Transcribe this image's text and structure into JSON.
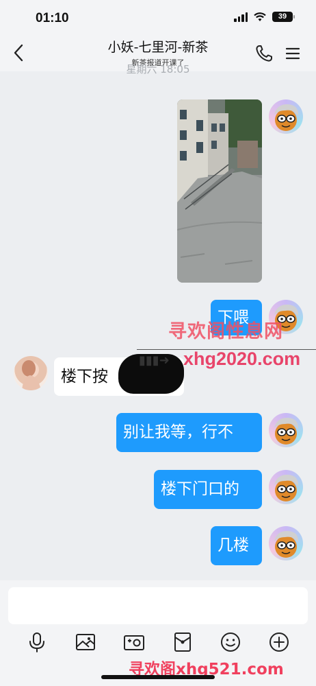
{
  "status_bar": {
    "time": "01:10",
    "battery": "39"
  },
  "header": {
    "title": "小妖-七里河-新茶",
    "subtitle": "新茶报道开课了"
  },
  "chat": {
    "timestamp": "星期六 18:05",
    "messages": [
      {
        "from": "self",
        "type": "image",
        "description": "photo"
      },
      {
        "from": "self",
        "type": "text",
        "text": "下喂"
      },
      {
        "from": "other",
        "type": "text",
        "text": "楼下按"
      },
      {
        "from": "self",
        "type": "text",
        "text": "别让我等，行不"
      },
      {
        "from": "self",
        "type": "text",
        "text": "楼下门口的"
      },
      {
        "from": "self",
        "type": "text",
        "text": "几楼"
      }
    ]
  },
  "watermarks": {
    "site_name": "寻欢阁性息网",
    "site_url": "xhg2020.com",
    "footer": "寻欢阁xhg521.com"
  },
  "input": {
    "placeholder": ""
  },
  "toolbar": {
    "icons": [
      "microphone-icon",
      "image-icon",
      "camera-icon",
      "red-packet-icon",
      "emoji-icon",
      "plus-icon"
    ]
  },
  "colors": {
    "self_bubble": "#1e9bfd",
    "other_bubble": "#ffffff",
    "background": "#eceef1"
  }
}
